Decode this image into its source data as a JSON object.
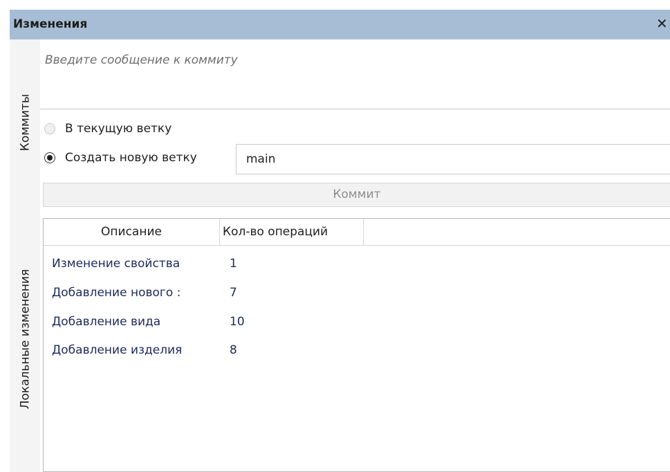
{
  "window": {
    "title": "Изменения",
    "close_glyph": "✕"
  },
  "tabs": {
    "commits": "Коммиты",
    "local_changes": "Локальные изменения"
  },
  "commit": {
    "message_placeholder": "Введите сообщение к коммиту",
    "radio_current_label": "В текущую ветку",
    "radio_new_label": "Создать новую ветку",
    "selected_option": "new_branch",
    "branch_name": "main",
    "commit_button": "Коммит"
  },
  "table": {
    "columns": [
      "Описание",
      "Кол-во операций"
    ],
    "rows": [
      {
        "description": "Изменение свойства",
        "count": "1"
      },
      {
        "description": "Добавление нового :",
        "count": "7"
      },
      {
        "description": "Добавление вида",
        "count": "10"
      },
      {
        "description": "Добавление изделия",
        "count": "8"
      }
    ]
  },
  "colors": {
    "titlebar": "#a7bdd6",
    "cell_text": "#1e2a5a",
    "disabled_text": "#8f8f8f"
  }
}
